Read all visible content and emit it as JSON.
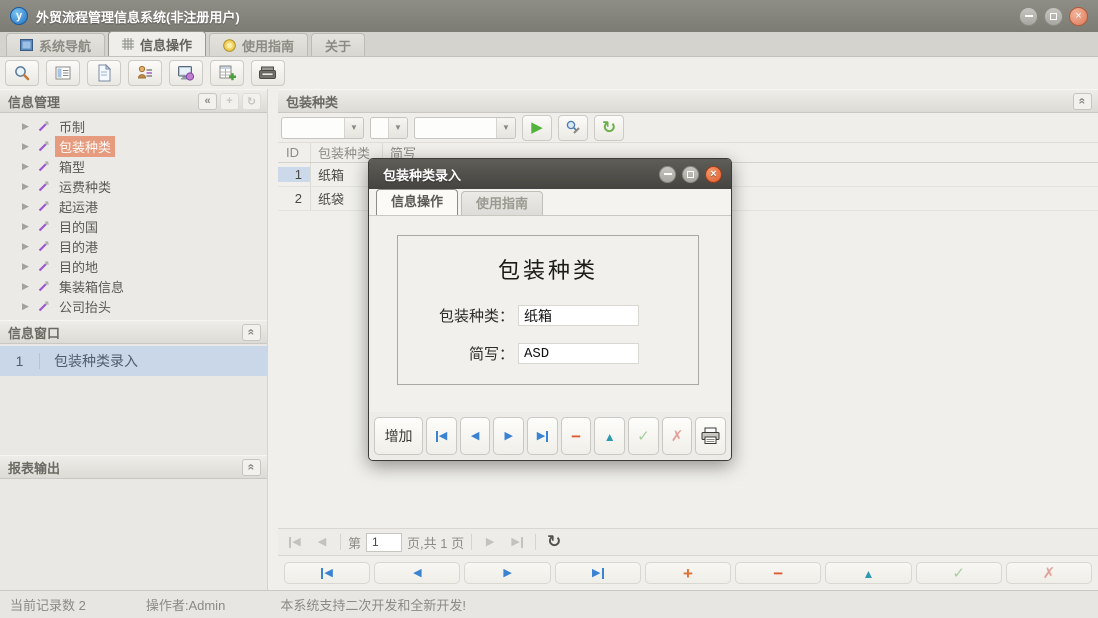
{
  "window": {
    "title": "外贸流程管理信息系统(非注册用户)"
  },
  "tabs": [
    {
      "label": "系统导航",
      "icon": "window-icon",
      "active": false
    },
    {
      "label": "信息操作",
      "icon": "grid-icon",
      "active": true
    },
    {
      "label": "使用指南",
      "icon": "guide-icon",
      "active": false
    },
    {
      "label": "关于",
      "icon": null,
      "active": false
    }
  ],
  "toolbar": {
    "buttons": [
      "search",
      "list-view",
      "new-document",
      "user-manage",
      "monitor-view",
      "table-add",
      "archive"
    ]
  },
  "sidebar": {
    "panel_info_title": "信息管理",
    "tree_items": [
      "币制",
      "包装种类",
      "箱型",
      "运费种类",
      "起运港",
      "目的国",
      "目的港",
      "目的地",
      "集装箱信息",
      "公司抬头"
    ],
    "selected_item": "包装种类",
    "panel_window_title": "信息窗口",
    "window_item": {
      "num": "1",
      "label": "包装种类录入"
    },
    "panel_report_title": "报表输出"
  },
  "main": {
    "panel_title": "包装种类",
    "columns": [
      "ID",
      "包装种类",
      "简写"
    ],
    "rows": [
      [
        "1",
        "纸箱"
      ],
      [
        "2",
        "纸袋"
      ]
    ],
    "pagination": {
      "prefix": "第",
      "page": "1",
      "suffix": "页,共 1 页"
    }
  },
  "dialog": {
    "title": "包装种类录入",
    "tabs": [
      {
        "label": "信息操作",
        "active": true
      },
      {
        "label": "使用指南",
        "active": false
      }
    ],
    "form": {
      "title": "包装种类",
      "fields": [
        {
          "label": "包装种类：",
          "value": "纸箱"
        },
        {
          "label": "简写：",
          "value": "ASD"
        }
      ]
    },
    "buttons": {
      "add": "增加"
    }
  },
  "statusbar": {
    "records": "当前记录数 2",
    "operator": "操作者:Admin",
    "message": "本系统支持二次开发和全新开发!"
  },
  "colors": {
    "selected_tree_bg": "#e69b7e",
    "selection_blue": "#c9d7e9",
    "titlebar": "#83827b",
    "dialog_titlebar": "#4c4b46",
    "arrow_blue": "#3a82d2",
    "action_orange": "#df7038",
    "action_teal": "#2d9ab0"
  }
}
